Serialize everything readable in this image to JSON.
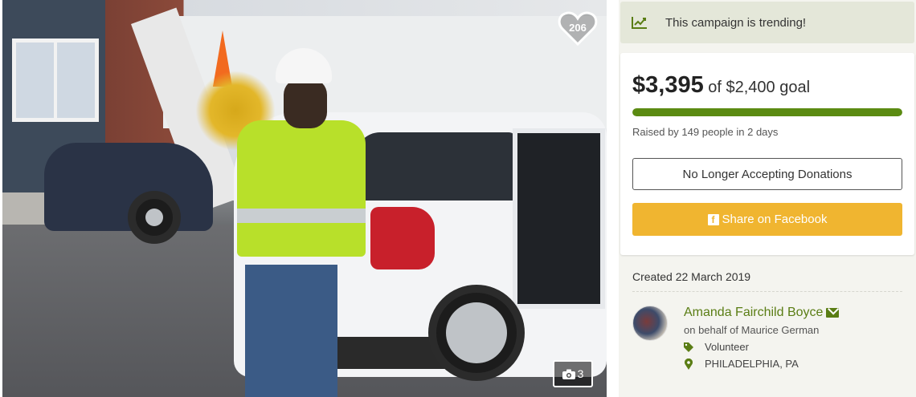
{
  "photo": {
    "heart_count": "206",
    "photo_count": "3",
    "heart_icon": "heart-icon",
    "camera_icon": "camera-icon"
  },
  "trending": {
    "text": "This campaign is trending!",
    "icon": "trend-chart-icon"
  },
  "funding": {
    "raised": "$3,395",
    "goal_text": "of $2,400 goal",
    "progress_fraction": 1.0,
    "raised_by": "Raised by 149 people in 2 days",
    "status_button": "No Longer Accepting Donations",
    "share_button": "Share on Facebook",
    "accent_color": "#5b8b12",
    "share_color": "#f0b530"
  },
  "details": {
    "created": "Created 22 March 2019",
    "organizer_name": "Amanda Fairchild Boyce",
    "behalf": "on behalf of Maurice German",
    "role": "Volunteer",
    "location": "PHILADELPHIA, PA"
  }
}
